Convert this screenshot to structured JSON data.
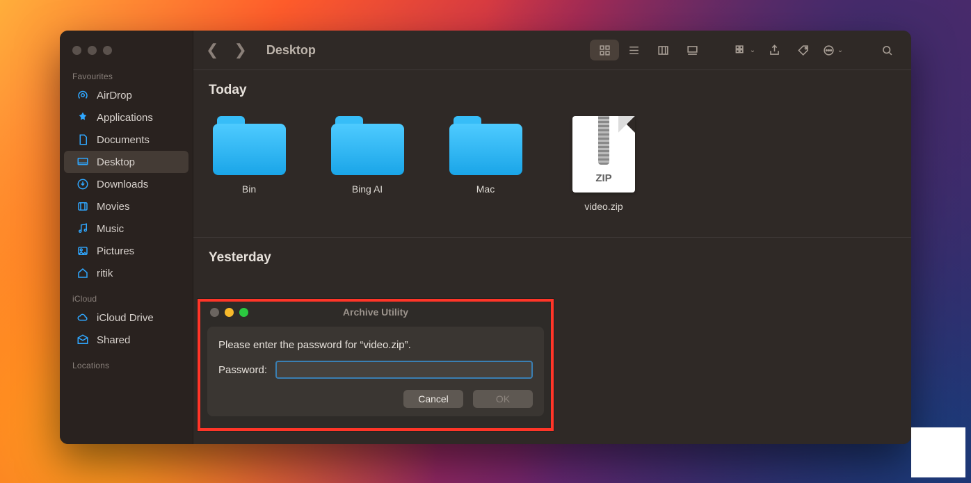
{
  "finder": {
    "location": "Desktop",
    "sidebar": {
      "sections": [
        {
          "heading": "Favourites",
          "items": [
            {
              "label": "AirDrop",
              "icon": "airdrop-icon"
            },
            {
              "label": "Applications",
              "icon": "apps-icon"
            },
            {
              "label": "Documents",
              "icon": "documents-icon"
            },
            {
              "label": "Desktop",
              "icon": "desktop-icon",
              "selected": true
            },
            {
              "label": "Downloads",
              "icon": "downloads-icon"
            },
            {
              "label": "Movies",
              "icon": "movies-icon"
            },
            {
              "label": "Music",
              "icon": "music-icon"
            },
            {
              "label": "Pictures",
              "icon": "pictures-icon"
            },
            {
              "label": "ritik",
              "icon": "home-icon"
            }
          ]
        },
        {
          "heading": "iCloud",
          "items": [
            {
              "label": "iCloud Drive",
              "icon": "icloud-icon"
            },
            {
              "label": "Shared",
              "icon": "shared-icon"
            }
          ]
        },
        {
          "heading": "Locations",
          "items": []
        }
      ]
    },
    "sections": [
      {
        "title": "Today",
        "items": [
          {
            "name": "Bin",
            "type": "folder"
          },
          {
            "name": "Bing AI",
            "type": "folder"
          },
          {
            "name": "Mac",
            "type": "folder"
          },
          {
            "name": "video.zip",
            "type": "zip",
            "badge": "ZIP"
          }
        ]
      },
      {
        "title": "Yesterday",
        "items": []
      }
    ]
  },
  "dialog": {
    "app": "Archive Utility",
    "message": "Please enter the password for “video.zip”.",
    "field_label": "Password:",
    "input_value": "",
    "cancel": "Cancel",
    "ok": "OK"
  }
}
